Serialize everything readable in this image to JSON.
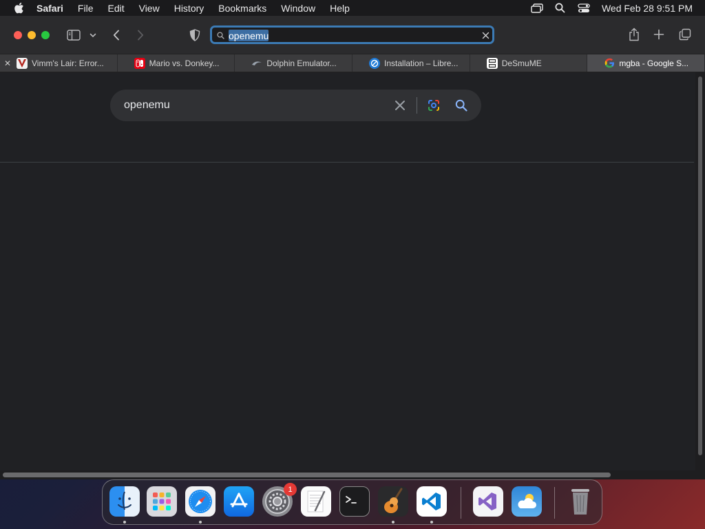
{
  "menubar": {
    "app_name": "Safari",
    "items": [
      {
        "label": "File"
      },
      {
        "label": "Edit"
      },
      {
        "label": "View"
      },
      {
        "label": "History"
      },
      {
        "label": "Bookmarks"
      },
      {
        "label": "Window"
      },
      {
        "label": "Help"
      }
    ],
    "status_icons": [
      "screen-mirroring-icon",
      "spotlight-search-icon",
      "control-center-icon"
    ],
    "clock": "Wed Feb 28  9:51 PM"
  },
  "toolbar": {
    "address": {
      "value": "openemu",
      "icons": [
        "search-icon",
        "clear-icon"
      ]
    },
    "icons": [
      "sidebar-icon",
      "chevron-down-icon",
      "back-icon",
      "forward-icon",
      "privacy-shield-icon",
      "share-icon",
      "new-tab-icon",
      "tab-overview-icon"
    ]
  },
  "tabs": [
    {
      "label": "Vimm's Lair: Error...",
      "favicon": "vimms-lair-icon",
      "active": false
    },
    {
      "label": "Mario vs. Donkey...",
      "favicon": "nintendo-switch-icon",
      "active": false
    },
    {
      "label": "Dolphin Emulator...",
      "favicon": "dolphin-icon",
      "active": false
    },
    {
      "label": "Installation – Libre...",
      "favicon": "libretro-icon",
      "active": false
    },
    {
      "label": "DeSmuME",
      "favicon": "desmume-icon",
      "active": false
    },
    {
      "label": "mgba - Google S...",
      "favicon": "google-icon",
      "active": true
    }
  ],
  "page": {
    "search_query": "openemu",
    "icons": [
      "clear-icon",
      "google-lens-icon",
      "search-icon"
    ]
  },
  "dock": {
    "apps": [
      {
        "name": "Finder",
        "icon": "finder-icon",
        "running": true
      },
      {
        "name": "Launchpad",
        "icon": "launchpad-icon",
        "running": false
      },
      {
        "name": "Safari",
        "icon": "safari-icon",
        "running": true
      },
      {
        "name": "App Store",
        "icon": "app-store-icon",
        "running": false
      },
      {
        "name": "System Settings",
        "icon": "system-settings-icon",
        "running": false,
        "badge": "1"
      },
      {
        "name": "TextEdit",
        "icon": "textedit-icon",
        "running": false
      },
      {
        "name": "Terminal",
        "icon": "terminal-icon",
        "running": false
      },
      {
        "name": "GarageBand",
        "icon": "garageband-icon",
        "running": true
      },
      {
        "name": "Visual Studio Code",
        "icon": "vscode-icon",
        "running": true
      },
      {
        "name": "Visual Studio",
        "icon": "visual-studio-icon",
        "running": false
      },
      {
        "name": "Weather",
        "icon": "weather-icon",
        "running": false
      },
      {
        "name": "Trash",
        "icon": "trash-icon",
        "running": false
      }
    ]
  },
  "colors": {
    "accent_focus_ring": "#3c7bb5",
    "page_background": "#202124",
    "search_box": "#303134",
    "badge_red": "#e53935"
  }
}
